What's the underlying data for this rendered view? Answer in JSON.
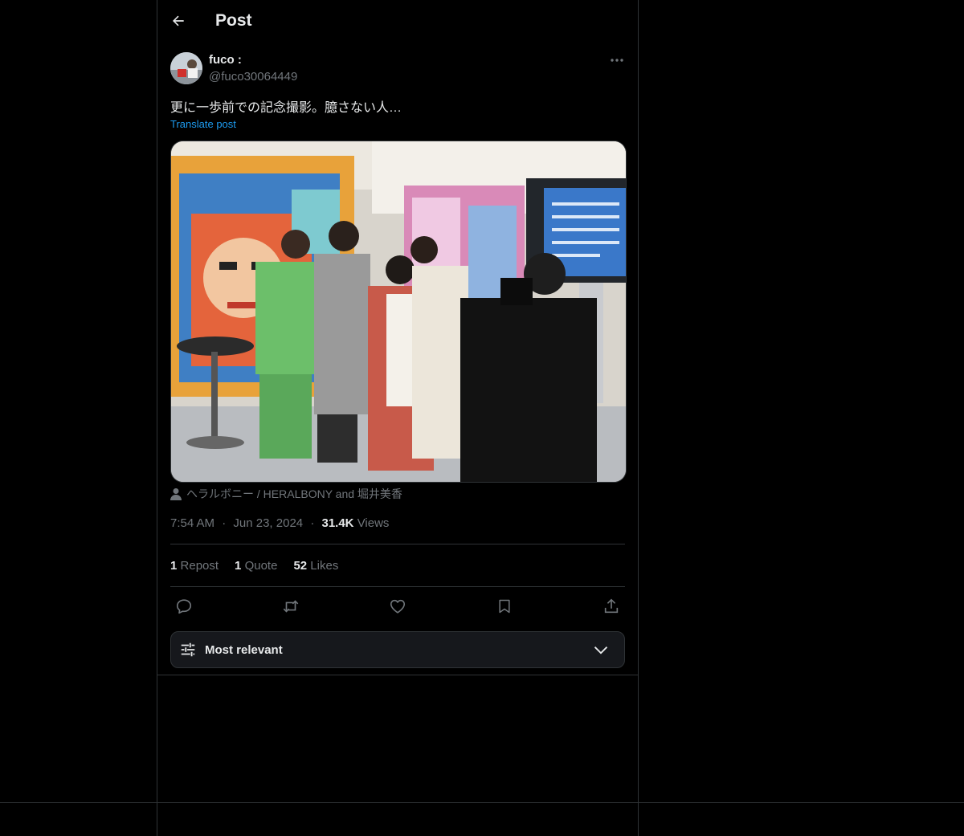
{
  "header": {
    "title": "Post"
  },
  "post": {
    "author_name": "fuco :",
    "author_handle": "@fuco30064449",
    "text": "更に一歩前での記念撮影。臆さない人…",
    "translate_label": "Translate post",
    "media_tags": "ヘラルボニー / HERALBONY and 堀井美香",
    "time": "7:54 AM",
    "date": "Jun 23, 2024",
    "views_count": "31.4K",
    "views_label": "Views",
    "separator": "·"
  },
  "stats": {
    "reposts_count": "1",
    "reposts_label": "Repost",
    "quotes_count": "1",
    "quotes_label": "Quote",
    "likes_count": "52",
    "likes_label": "Likes"
  },
  "actions": [
    "reply-icon",
    "repost-icon",
    "like-icon",
    "bookmark-icon",
    "share-icon"
  ],
  "sort": {
    "label": "Most relevant"
  },
  "colors": {
    "background": "#000000",
    "text": "#e7e9ea",
    "muted": "#71767b",
    "accent": "#1d9bf0",
    "border": "#2f3336"
  }
}
